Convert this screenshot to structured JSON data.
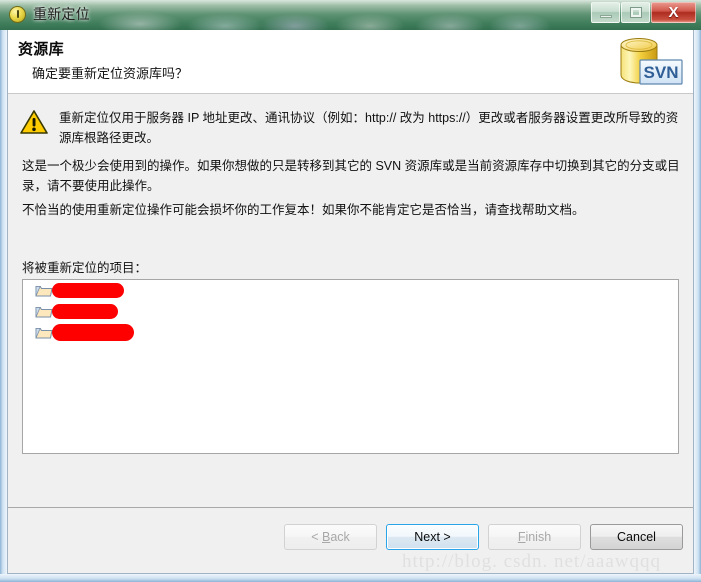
{
  "window": {
    "title": "重新定位",
    "icon": "subversion-circle-icon",
    "controls": {
      "minimize": "minimize-button",
      "maximize": "maximize-button",
      "close_glyph": "X"
    }
  },
  "header": {
    "title": "资源库",
    "subtitle": "确定要重新定位资源库吗？",
    "brand_icon_label": "SVN"
  },
  "body": {
    "warning": "重新定位仅用于服务器 IP 地址更改、通讯协议（例如：http:// 改为 https://）更改或者服务器设置更改所导致的资源库根路径更改。",
    "paragraph_2": "这是一个极少会使用到的操作。如果你想做的只是转移到其它的 SVN 资源库或是当前资源库存中切换到其它的分支或目录，请不要使用此操作。",
    "paragraph_3": "不恰当的使用重新定位操作可能会损坏你的工作复本！如果你不能肯定它是否恰当，请查找帮助文档。",
    "list_label": "将被重新定位的项目：",
    "items": [
      {
        "label": "",
        "redacted": true,
        "redaction_width": 72
      },
      {
        "label": "",
        "redacted": true,
        "redaction_width": 66
      },
      {
        "label": "",
        "redacted": true,
        "redaction_width": 82
      }
    ]
  },
  "footer": {
    "buttons": [
      {
        "name": "back-button",
        "label": "< Back",
        "mnemonic": "B",
        "state": "disabled"
      },
      {
        "name": "next-button",
        "label": "Next >",
        "mnemonic": "",
        "state": "default"
      },
      {
        "name": "finish-button",
        "label": "Finish",
        "mnemonic": "F",
        "state": "disabled"
      },
      {
        "name": "cancel-button",
        "label": "Cancel",
        "mnemonic": "",
        "state": "enabled"
      }
    ]
  },
  "watermark": "http://blog. csdn. net/aaawqqq",
  "colors": {
    "titlebar_green": "#3f7d5b",
    "close_red": "#ad2c20",
    "default_button_focus": "#2aa4e8",
    "warning_yellow": "#ffcc00",
    "redaction_red": "#fe0000",
    "header_white": "#ffffff",
    "body_gray": "#f0f0f0"
  }
}
